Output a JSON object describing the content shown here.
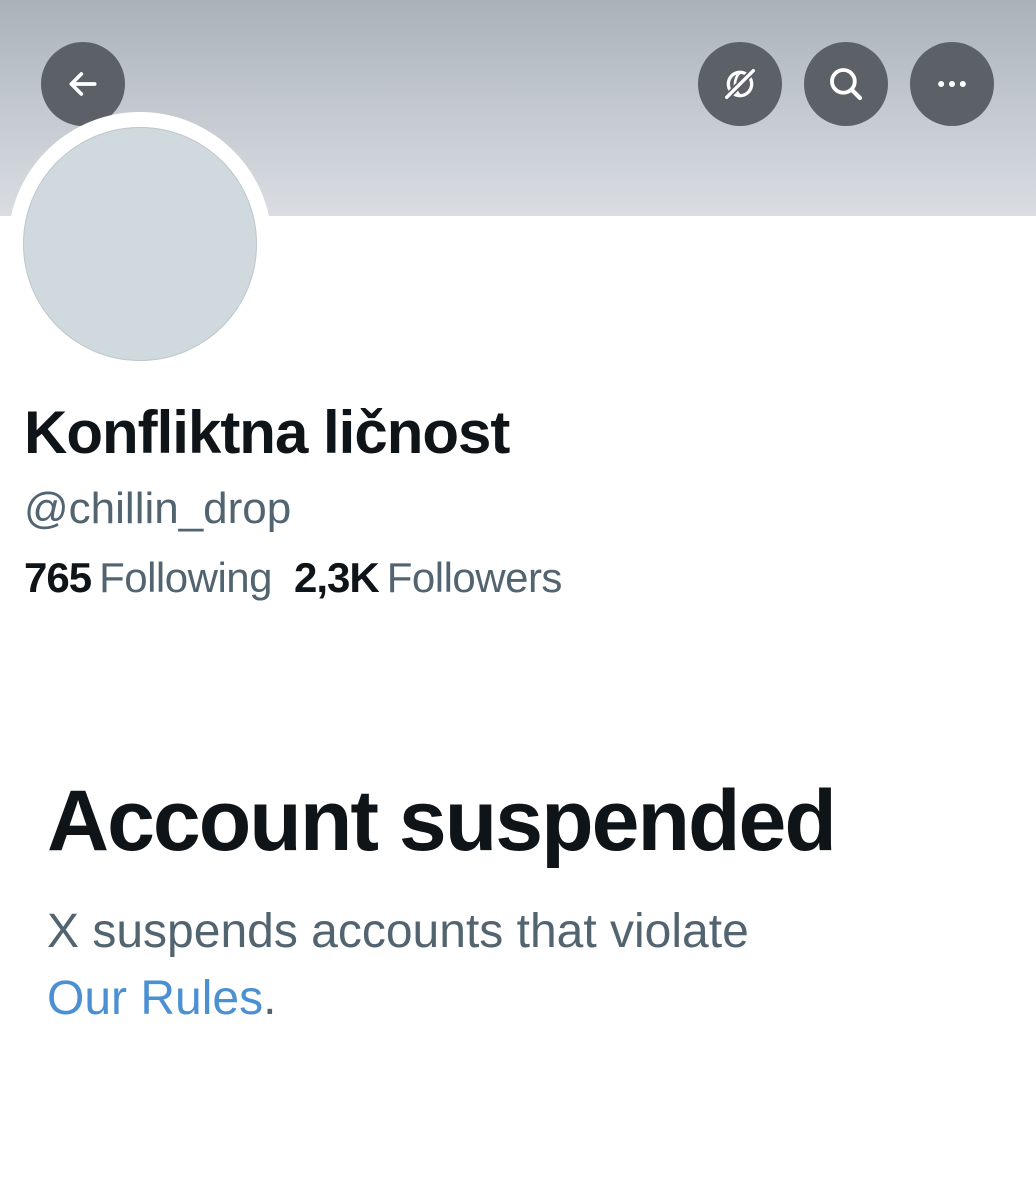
{
  "header": {
    "back_icon": "arrow-left-icon",
    "translate_icon": "translate-off-icon",
    "search_icon": "search-icon",
    "more_icon": "more-horizontal-icon"
  },
  "profile": {
    "display_name": "Konfliktna ličnost",
    "handle": "@chillin_drop",
    "following_count": "765",
    "following_label": "Following",
    "followers_count": "2,3K",
    "followers_label": "Followers"
  },
  "suspension": {
    "title": "Account suspended",
    "message": "X suspends accounts that violate",
    "link_text": "Our Rules",
    "trailing": "."
  },
  "colors": {
    "banner": "#c3c9cf",
    "button_bg": "#5b6166",
    "avatar": "#cfd9de",
    "secondary_text": "#536471",
    "link": "#4a90d2"
  }
}
